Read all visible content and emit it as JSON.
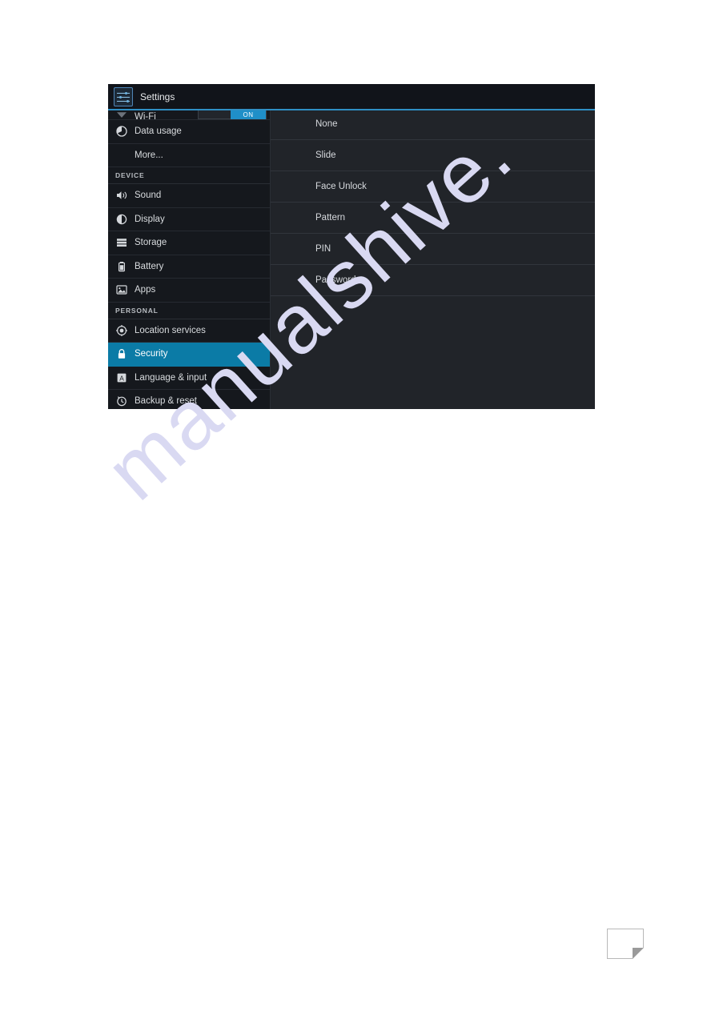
{
  "page": {
    "watermark_text": "manualshive.",
    "background_color": "#ffffff",
    "corner_fold_name": "page-corner-fold"
  },
  "window": {
    "titlebar": {
      "app_title": "Settings",
      "app_icon": "settings-sliders-icon"
    },
    "accent_color": "#2f8fc4",
    "selected_row_color": "#0b7ba6",
    "sidebar_bg": "#15181d",
    "content_bg": "#212429"
  },
  "sidebar": {
    "wifi": {
      "label": "Wi-Fi",
      "icon": "wifi-icon",
      "toggle_state": "ON"
    },
    "items_wireless": [
      {
        "label": "Data usage",
        "icon": "pie-chart-icon",
        "selected": false,
        "indent": false
      },
      {
        "label": "More...",
        "icon": "none",
        "selected": false,
        "indent": true
      }
    ],
    "section_device": "DEVICE",
    "items_device": [
      {
        "label": "Sound",
        "icon": "speaker-icon",
        "selected": false,
        "indent": false
      },
      {
        "label": "Display",
        "icon": "brightness-icon",
        "selected": false,
        "indent": false
      },
      {
        "label": "Storage",
        "icon": "storage-bars-icon",
        "selected": false,
        "indent": false
      },
      {
        "label": "Battery",
        "icon": "battery-icon",
        "selected": false,
        "indent": false
      },
      {
        "label": "Apps",
        "icon": "apps-image-icon",
        "selected": false,
        "indent": false
      }
    ],
    "section_personal": "PERSONAL",
    "items_personal": [
      {
        "label": "Location services",
        "icon": "location-target-icon",
        "selected": false,
        "indent": false
      },
      {
        "label": "Security",
        "icon": "lock-icon",
        "selected": true,
        "indent": false
      },
      {
        "label": "Language & input",
        "icon": "letter-a-box-icon",
        "selected": false,
        "indent": false
      },
      {
        "label": "Backup & reset",
        "icon": "restore-clock-icon",
        "selected": false,
        "indent": false
      }
    ]
  },
  "content": {
    "screen_lock_options": [
      {
        "label": "None"
      },
      {
        "label": "Slide"
      },
      {
        "label": "Face Unlock"
      },
      {
        "label": "Pattern"
      },
      {
        "label": "PIN"
      },
      {
        "label": "Password"
      }
    ]
  }
}
